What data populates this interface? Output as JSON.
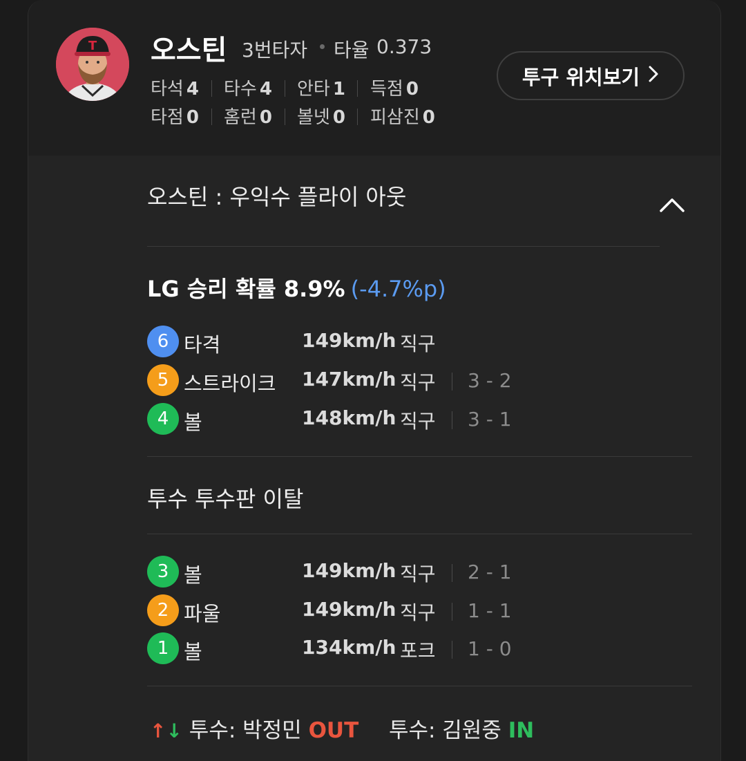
{
  "player": {
    "name": "오스틴",
    "batting_order": "3번타자",
    "avg_label": "타율",
    "avg_value": "0.373",
    "avatar_bg": "#d4485c"
  },
  "stats_row1": [
    {
      "label": "타석",
      "value": "4"
    },
    {
      "label": "타수",
      "value": "4"
    },
    {
      "label": "안타",
      "value": "1"
    },
    {
      "label": "득점",
      "value": "0"
    }
  ],
  "stats_row2": [
    {
      "label": "타점",
      "value": "0"
    },
    {
      "label": "홈런",
      "value": "0"
    },
    {
      "label": "볼넷",
      "value": "0"
    },
    {
      "label": "피삼진",
      "value": "0"
    }
  ],
  "pitch_button": {
    "label": "투구 위치보기",
    "icon": "chevron-right-icon"
  },
  "result": {
    "text": "오스틴 : 우익수 플라이 아웃",
    "collapse_icon": "chevron-up-icon"
  },
  "win_prob": {
    "label": "LG 승리 확률 8.9%",
    "delta": "(-4.7%p)",
    "delta_color": "#5b9bf1"
  },
  "pitches_group1": [
    {
      "num": "6",
      "type": "타격",
      "speed": "149km/h",
      "kind": "직구",
      "count": "",
      "color": "#4f8ff0"
    },
    {
      "num": "5",
      "type": "스트라이크",
      "speed": "147km/h",
      "kind": "직구",
      "count": "3 - 2",
      "color": "#f59d1a"
    },
    {
      "num": "4",
      "type": "볼",
      "speed": "148km/h",
      "kind": "직구",
      "count": "3 - 1",
      "color": "#1fbb57"
    }
  ],
  "event": {
    "text": "투수 투수판 이탈"
  },
  "pitches_group2": [
    {
      "num": "3",
      "type": "볼",
      "speed": "149km/h",
      "kind": "직구",
      "count": "2 - 1",
      "color": "#1fbb57"
    },
    {
      "num": "2",
      "type": "파울",
      "speed": "149km/h",
      "kind": "직구",
      "count": "1 - 1",
      "color": "#f59d1a"
    },
    {
      "num": "1",
      "type": "볼",
      "speed": "134km/h",
      "kind": "포크",
      "count": "1 - 0",
      "color": "#1fbb57"
    }
  ],
  "pitcher_change": {
    "arrows": "↑↓",
    "out_label": "투수: 박정민",
    "out_tag": "OUT",
    "in_label": "투수: 김원중",
    "in_tag": "IN",
    "out_color": "#e9553e",
    "in_color": "#2ebd5d"
  }
}
